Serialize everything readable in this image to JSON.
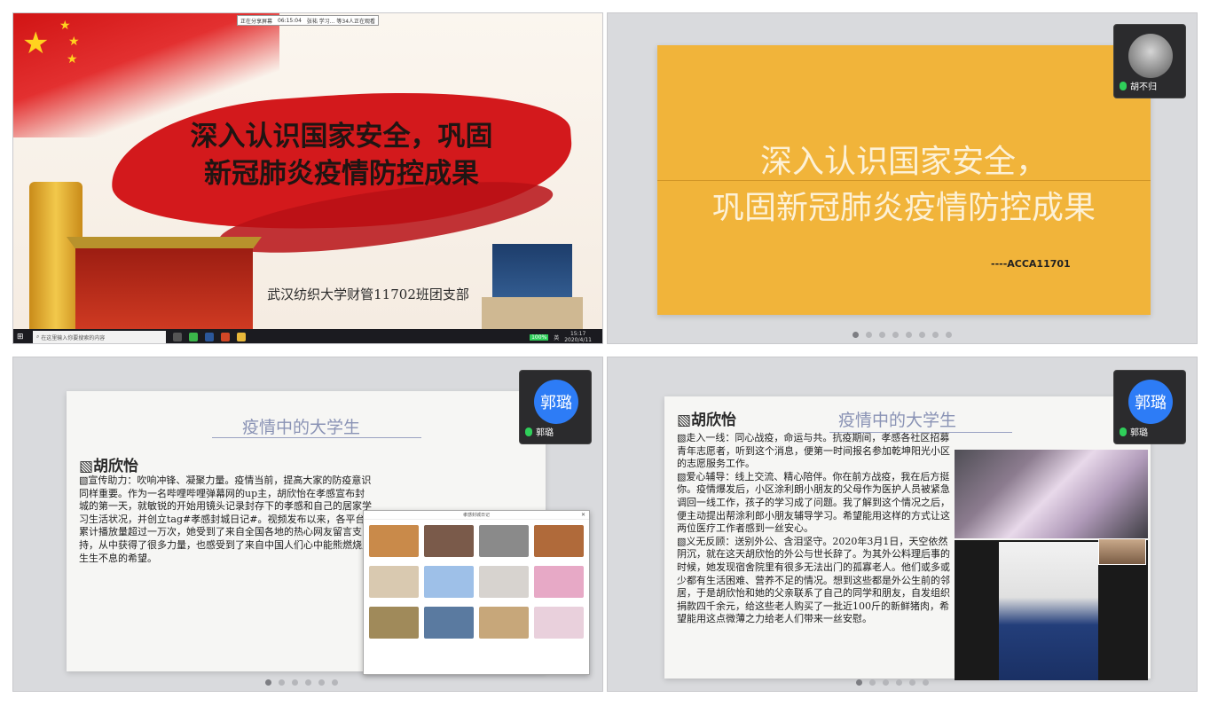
{
  "panel1": {
    "share_bar": [
      "正在分享屏幕",
      "06:15:04",
      "张祐 学习... 等34人正在观看"
    ],
    "title_line1": "深入认识国家安全，巩固",
    "title_line2": "新冠肺炎疫情防控成果",
    "subtitle": "武汉纺织大学财管11702班团支部",
    "taskbar": {
      "search_placeholder": "在这里输入你要搜索的内容",
      "battery": "100%",
      "ime": "英",
      "time": "15:17",
      "date": "2020/4/11"
    }
  },
  "panel2": {
    "title_line1": "深入认识国家安全，",
    "title_line2": "巩固新冠肺炎疫情防控成果",
    "signature": "----ACCA11701",
    "participant": "胡不归"
  },
  "panel3": {
    "heading": "疫情中的大学生",
    "name": "▧胡欣怡",
    "body": "▧宣传助力：吹响冲锋、凝聚力量。疫情当前，提高大家的防疫意识同样重要。作为一名哔哩哔哩弹幕网的up主，胡欣怡在孝感宣布封城的第一天，就敏锐的开始用镜头记录封存下的孝感和自己的居家学习生活状况，并创立tag#孝感封城日记#。视频发布以来，各平台累计播放量超过一万次，她受到了来自全国各地的热心网友留言支持，从中获得了很多力量，也感受到了来自中国人们心中能熊燃烧又生生不息的希望。",
    "participant": "郭璐",
    "avatar_text": "郭璐",
    "window_title": "孝感封城日记"
  },
  "panel4": {
    "heading": "疫情中的大学生",
    "name": "▧胡欣怡",
    "para1": "▧走入一线：同心战疫，命运与共。抗疫期间，孝感各社区招募青年志愿者，听到这个消息，便第一时间报名参加乾坤阳光小区的志愿服务工作。",
    "para2": "▧爱心辅导：线上交流、精心陪伴。你在前方战疫，我在后方挺你。疫情爆发后，小区涂利朗小朋友的父母作为医护人员被紧急调回一线工作，孩子的学习成了问题。我了解到这个情况之后，便主动提出帮涂利郎小朋友辅导学习。希望能用这样的方式让这两位医疗工作者感到一丝安心。",
    "para3": "▧义无反顾：送别外公、含泪坚守。2020年3月1日，天空依然阴沉，就在这天胡欣怡的外公与世长辞了。为其外公料理后事的时候，她发现宿舍院里有很多无法出门的孤寡老人。他们或多或少都有生活困难、营养不足的情况。想到这些都是外公生前的邻居，于是胡欣怡和她的父亲联系了自己的同学和朋友，自发组织捐款四千余元，给这些老人购买了一批近100斤的新鲜猪肉，希望能用这点微薄之力给老人们带来一丝安慰。",
    "participant": "郭璐",
    "avatar_text": "郭璐"
  },
  "colors": {
    "accent_red": "#d3191c",
    "paper_yellow": "#f1b43a",
    "avatar_blue": "#2d7cf6"
  }
}
